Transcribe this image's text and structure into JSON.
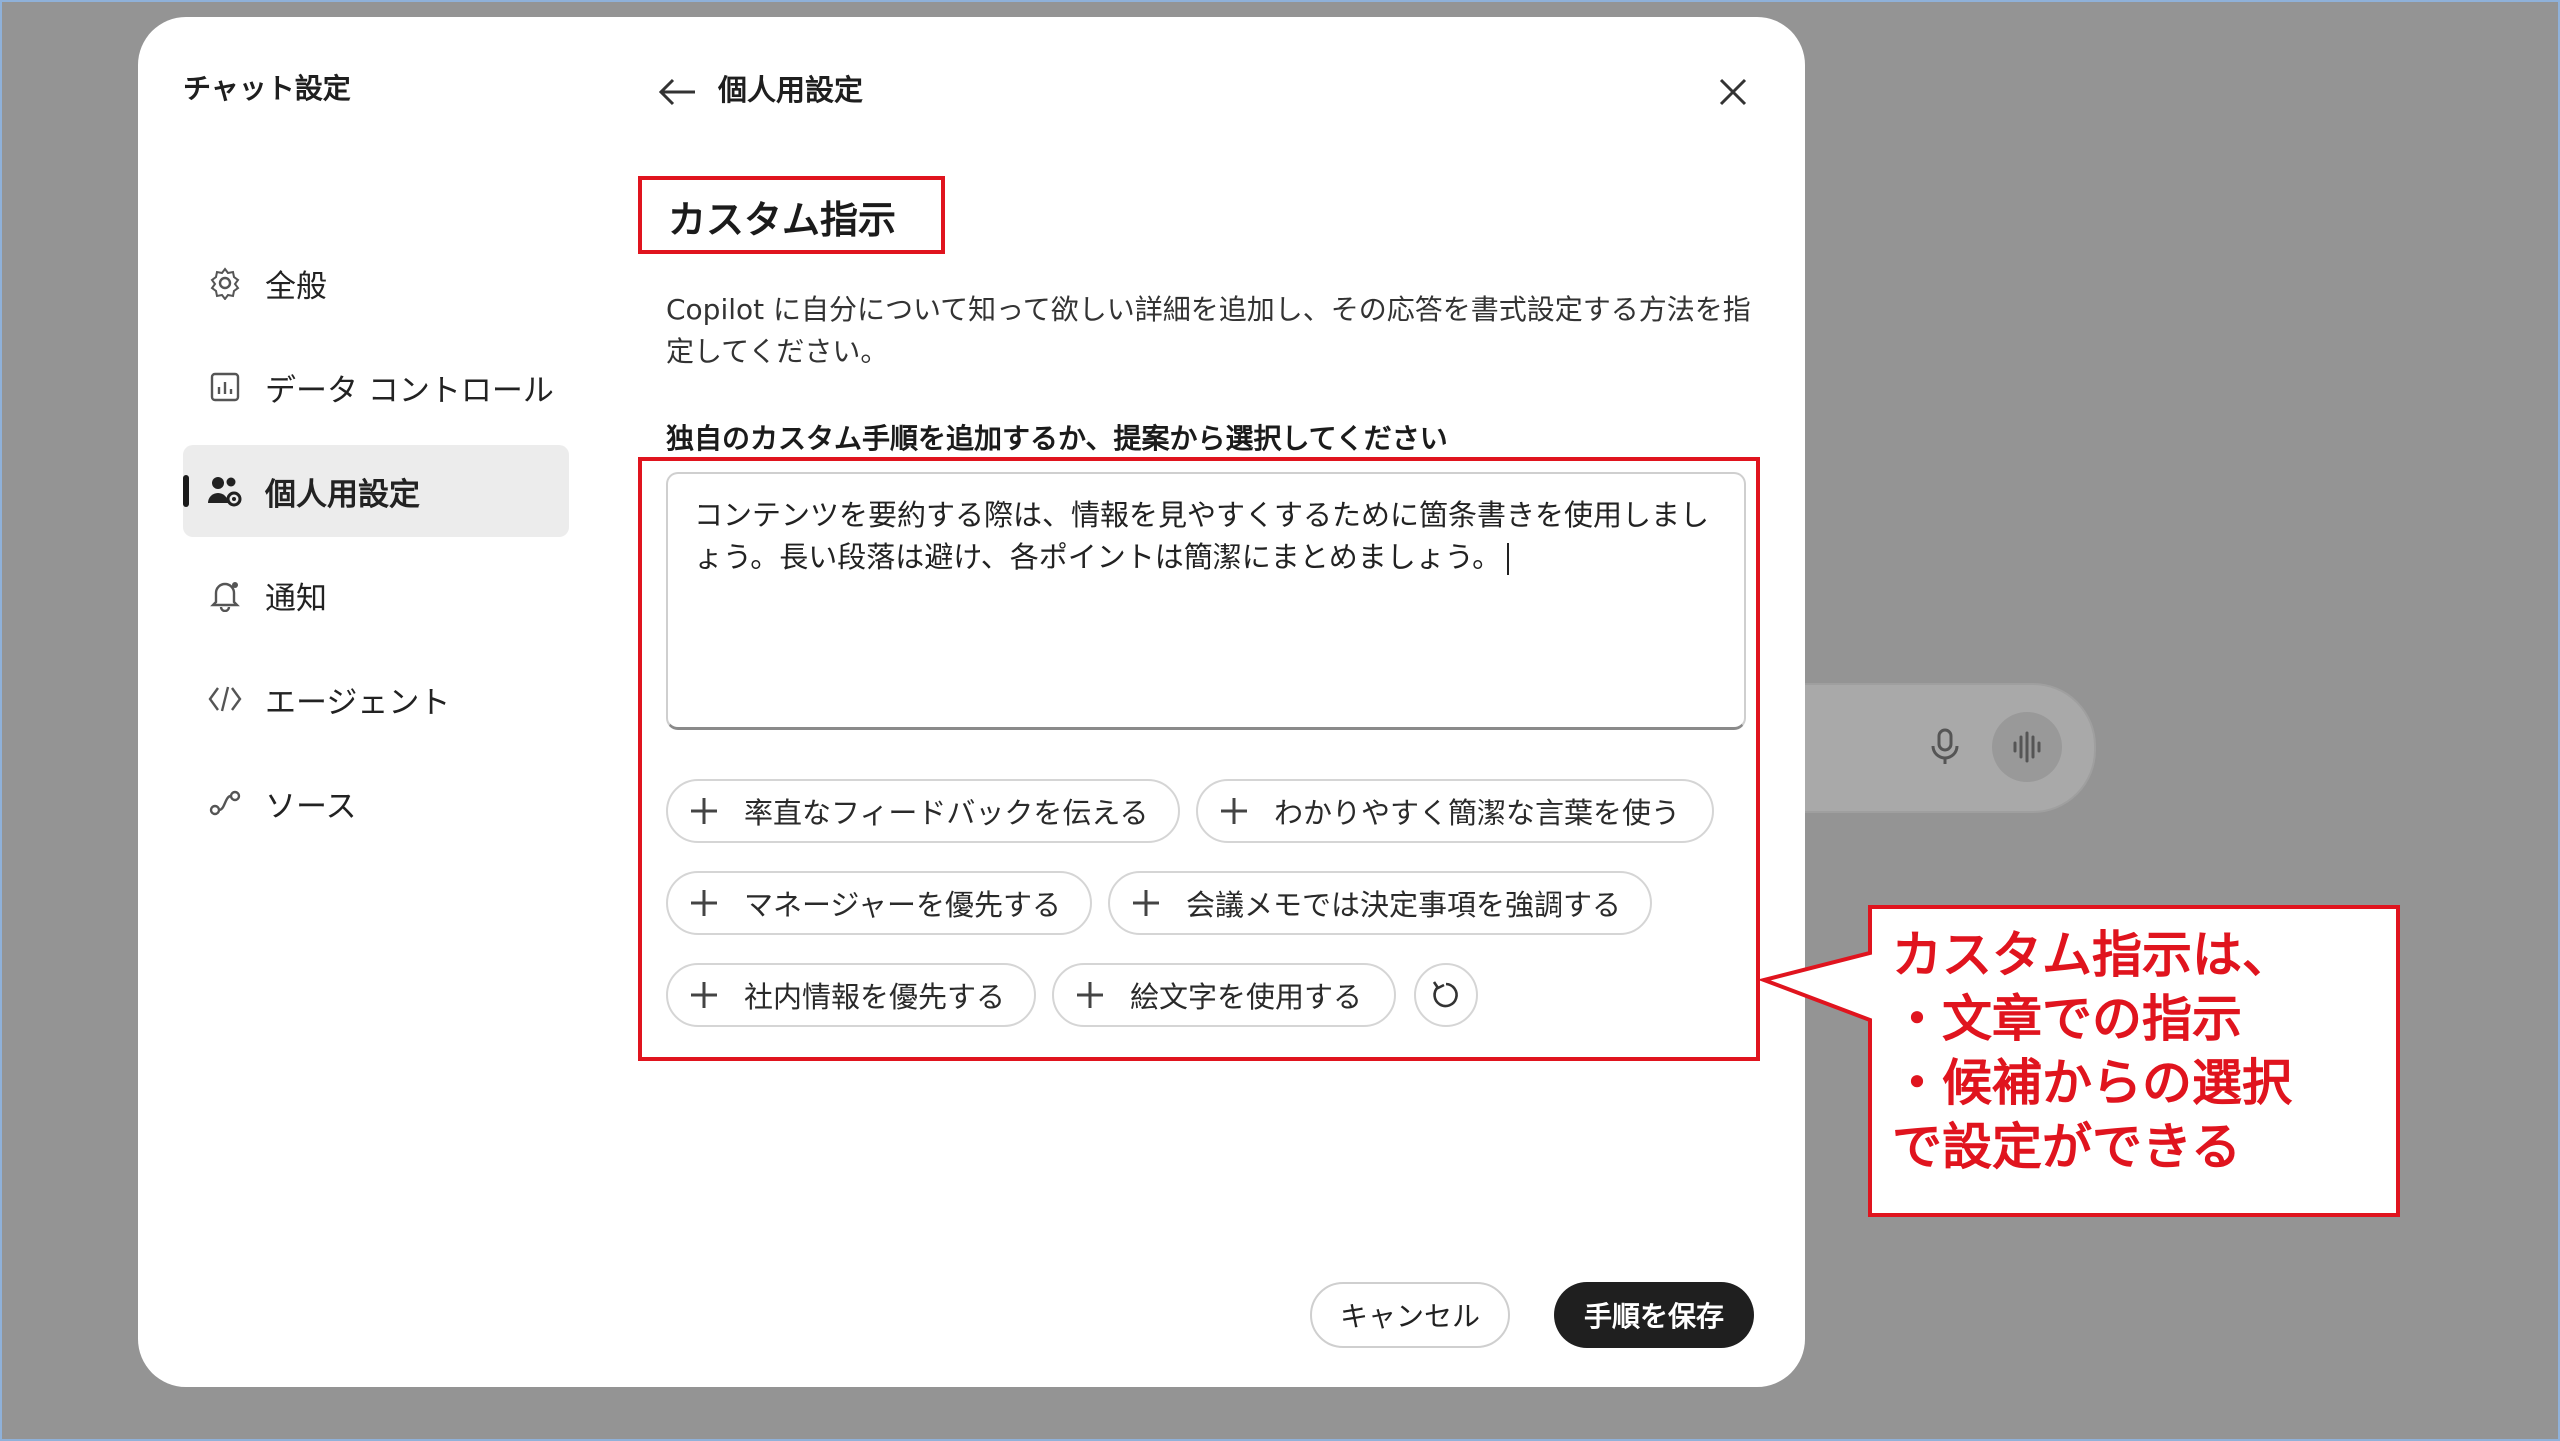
{
  "sidebar": {
    "title": "チャット設定",
    "items": [
      {
        "label": "全般",
        "icon": "gear-icon"
      },
      {
        "label": "データ コントロール",
        "icon": "chart-icon"
      },
      {
        "label": "個人用設定",
        "icon": "people-settings-icon"
      },
      {
        "label": "通知",
        "icon": "bell-icon"
      },
      {
        "label": "エージェント",
        "icon": "code-icon"
      },
      {
        "label": "ソース",
        "icon": "link-icon"
      }
    ],
    "active_index": 2
  },
  "header": {
    "title": "個人用設定"
  },
  "main": {
    "section_title": "カスタム指示",
    "description": "Copilot に自分について知って欲しい詳細を追加し、その応答を書式設定する方法を指定してください。",
    "field_label": "独自のカスタム手順を追加するか、提案から選択してください",
    "textarea_value": "コンテンツを要約する際は、情報を見やすくするために箇条書きを使用しましょう。長い段落は避け、各ポイントは簡潔にまとめましょう。",
    "suggestions": [
      "率直なフィードバックを伝える",
      "わかりやすく簡潔な言葉を使う",
      "マネージャーを優先する",
      "会議メモでは決定事項を強調する",
      "社内情報を優先する",
      "絵文字を使用する"
    ]
  },
  "footer": {
    "cancel_label": "キャンセル",
    "save_label": "手順を保存"
  },
  "annotation": {
    "line1": "カスタム指示は、",
    "line2": "・文章での指示",
    "line3": "・候補からの選択",
    "line4": "で設定ができる",
    "color": "#e0141e"
  }
}
